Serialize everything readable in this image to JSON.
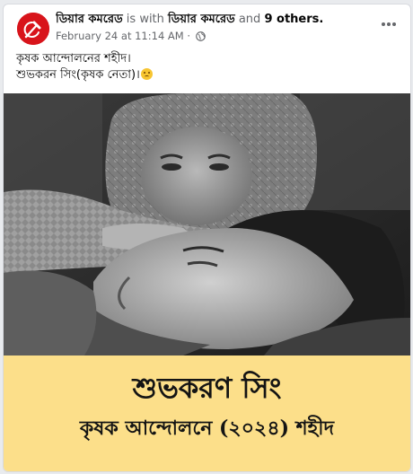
{
  "post": {
    "author": "ডিয়ার কমরেড",
    "is_with": "is with",
    "tagged_page": "ডিয়ার কমরেড",
    "and_text": "and",
    "others": "9 others.",
    "timestamp": "February 24 at 11:14 AM",
    "separator": "·",
    "privacy_icon": "globe-icon",
    "more_icon": "more-horizontal-icon"
  },
  "caption": {
    "line1": "কৃষক আন্দোলনের শহীদ।",
    "line2": "শুভকরন সিং(কৃষক নেতা)।",
    "emoji": "crying-face-emoji"
  },
  "image": {
    "banner_name": "শুভকরণ সিং",
    "banner_subtitle": "কৃষক আন্দোলনে (২০২৪) শহীদ"
  },
  "colors": {
    "avatar_bg": "#d8141b",
    "banner_bg": "#fcdf8a",
    "link_text": "#050505",
    "meta_text": "#65676b"
  }
}
